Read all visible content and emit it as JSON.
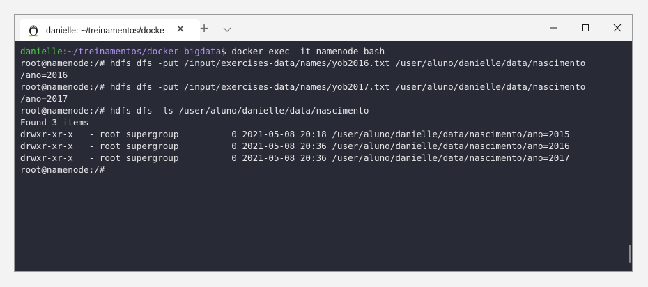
{
  "tab": {
    "title": "danielle: ~/treinamentos/docke",
    "close_glyph": "✕",
    "icon": "tux-linux-icon"
  },
  "titlebar": {
    "new_tab_glyph": "+",
    "dropdown_glyph": "⌵",
    "minimize_glyph": "—",
    "maximize_glyph": "☐",
    "close_glyph": "✕"
  },
  "terminal": {
    "prompt_user": "danielle",
    "prompt_colon": ":",
    "prompt_path": "~/treinamentos/docker-bigdata",
    "prompt_dollar": "$ ",
    "first_command": "docker exec -it namenode bash",
    "lines": [
      "root@namenode:/# hdfs dfs -put /input/exercises-data/names/yob2016.txt /user/aluno/danielle/data/nascimento",
      "/ano=2016",
      "root@namenode:/# hdfs dfs -put /input/exercises-data/names/yob2017.txt /user/aluno/danielle/data/nascimento",
      "/ano=2017",
      "root@namenode:/# hdfs dfs -ls /user/aluno/danielle/data/nascimento",
      "Found 3 items",
      "drwxr-xr-x   - root supergroup          0 2021-05-08 20:18 /user/aluno/danielle/data/nascimento/ano=2015",
      "drwxr-xr-x   - root supergroup          0 2021-05-08 20:36 /user/aluno/danielle/data/nascimento/ano=2016",
      "drwxr-xr-x   - root supergroup          0 2021-05-08 20:36 /user/aluno/danielle/data/nascimento/ano=2017"
    ],
    "last_prompt": "root@namenode:/# ",
    "colors": {
      "background": "#282b36",
      "text": "#e6e6e6",
      "user": "#4ec94a",
      "path": "#b392f0"
    }
  }
}
